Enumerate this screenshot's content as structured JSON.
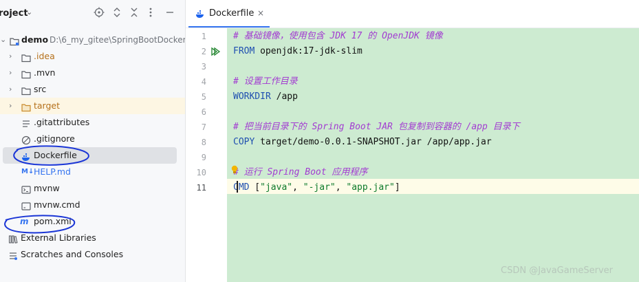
{
  "project_panel": {
    "title": "roject",
    "root": {
      "name": "demo",
      "path": "D:\\6_my_gitee\\SpringBootDocker\\"
    },
    "items": [
      {
        "label": ".idea"
      },
      {
        "label": ".mvn"
      },
      {
        "label": "src"
      },
      {
        "label": "target"
      },
      {
        "label": ".gitattributes"
      },
      {
        "label": ".gitignore"
      },
      {
        "label": "Dockerfile"
      },
      {
        "label": "HELP.md"
      },
      {
        "label": "mvnw"
      },
      {
        "label": "mvnw.cmd"
      },
      {
        "label": "pom.xml"
      }
    ],
    "external_libraries": "External Libraries",
    "scratches": "Scratches and Consoles"
  },
  "editor": {
    "tab_label": "Dockerfile",
    "tab_close": "×",
    "line_numbers": [
      "1",
      "2",
      "3",
      "4",
      "5",
      "6",
      "7",
      "8",
      "9",
      "10",
      "11"
    ],
    "lines": {
      "l1": "# 基础镜像，使用包含 JDK 17 的 OpenJDK 镜像",
      "l2_kw": "FROM",
      "l2_rest": " openjdk:17-jdk-slim",
      "l4": "# 设置工作目录",
      "l5_kw": "WORKDIR",
      "l5_rest": " /app",
      "l7": "# 把当前目录下的 Spring Boot JAR 包复制到容器的 /app 目录下",
      "l8_kw": "COPY",
      "l8_rest": " target/demo-0.0.1-SNAPSHOT.jar /app/app.jar",
      "l10": "# 运行 Spring Boot 应用程序",
      "l11_kw": "CMD",
      "l11_a": " [",
      "l11_s1": "\"java\"",
      "l11_c1": ", ",
      "l11_s2": "\"-jar\"",
      "l11_c2": ", ",
      "l11_s3": "\"app.jar\"",
      "l11_b": "]"
    }
  },
  "watermark": "CSDN @JavaGameServer",
  "colors": {
    "code_background": "#cdebd1",
    "comment": "#a23bd1",
    "keyword": "#1f4fb0",
    "string": "#0d7a2b",
    "annotation": "#1a35d6"
  }
}
